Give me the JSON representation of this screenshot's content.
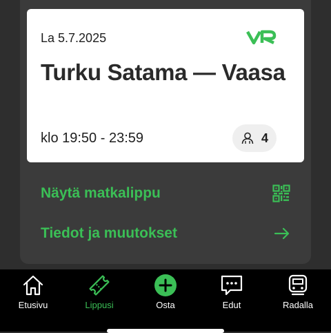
{
  "ticket": {
    "date": "La 5.7.2025",
    "route": "Turku Satama — Vaasa",
    "time": "klo 19:50 - 23:59",
    "passengers": "4",
    "brand": "VR"
  },
  "actions": {
    "show_ticket": "Näytä matkalippu",
    "details": "Tiedot ja muutokset"
  },
  "nav": {
    "items": [
      {
        "label": "Etusivu",
        "icon": "home-icon",
        "active": false
      },
      {
        "label": "Lippusi",
        "icon": "ticket-icon",
        "active": true
      },
      {
        "label": "Osta",
        "icon": "plus-icon",
        "active": false
      },
      {
        "label": "Edut",
        "icon": "chat-icon",
        "active": false
      },
      {
        "label": "Radalla",
        "icon": "train-icon",
        "active": false
      }
    ]
  },
  "colors": {
    "accent": "#3bbf56",
    "background": "#2e2e2e",
    "card": "#ffffff",
    "nav": "#000000"
  }
}
